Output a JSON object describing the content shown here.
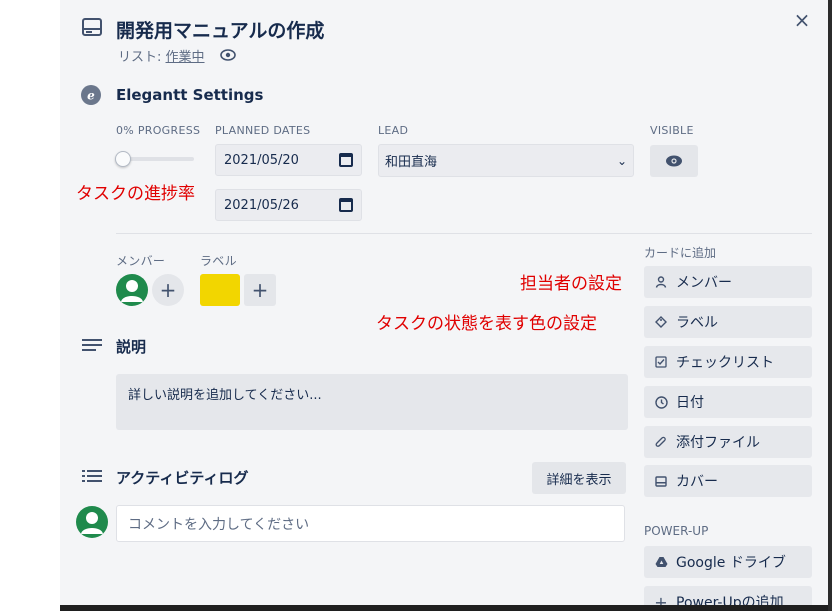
{
  "card": {
    "title": "開発用マニュアルの作成",
    "list_prefix": "リスト: ",
    "list_name": "作業中",
    "close_label": "×"
  },
  "elegantt": {
    "title": "Elegantt Settings",
    "progress_caption": "0% PROGRESS",
    "progress_value": 0,
    "dates_caption": "PLANNED DATES",
    "start_date": "2021/05/20",
    "end_date": "2021/05/26",
    "lead_caption": "LEAD",
    "lead_value": "和田直海",
    "visible_caption": "VISIBLE"
  },
  "annotations": {
    "progress": "タスクの進捗率",
    "member": "担当者の設定",
    "label": "タスクの状態を表す色の設定"
  },
  "members": {
    "caption": "メンバー",
    "add_label": "+"
  },
  "labels": {
    "caption": "ラベル",
    "add_label": "+",
    "chip_color": "#f2d600"
  },
  "description": {
    "title": "説明",
    "placeholder": "詳しい説明を追加してください..."
  },
  "activity": {
    "title": "アクティビティログ",
    "details_button": "詳細を表示",
    "comment_placeholder": "コメントを入力してください"
  },
  "sidebar": {
    "add_caption": "カードに追加",
    "buttons": [
      {
        "label": "メンバー",
        "icon": "person-icon"
      },
      {
        "label": "ラベル",
        "icon": "tag-icon"
      },
      {
        "label": "チェックリスト",
        "icon": "checklist-icon"
      },
      {
        "label": "日付",
        "icon": "clock-icon"
      },
      {
        "label": "添付ファイル",
        "icon": "paperclip-icon"
      },
      {
        "label": "カバー",
        "icon": "cover-icon"
      }
    ],
    "powerup_caption": "POWER-UP",
    "powerup_buttons": [
      {
        "label": "Google ドライブ",
        "icon": "google-drive-icon"
      },
      {
        "label": "Power-Upの追加",
        "icon": "plus-icon"
      }
    ]
  },
  "colors": {
    "annotation": "#e00000",
    "avatar": "#1f8a4c",
    "label_yellow": "#f2d600"
  }
}
